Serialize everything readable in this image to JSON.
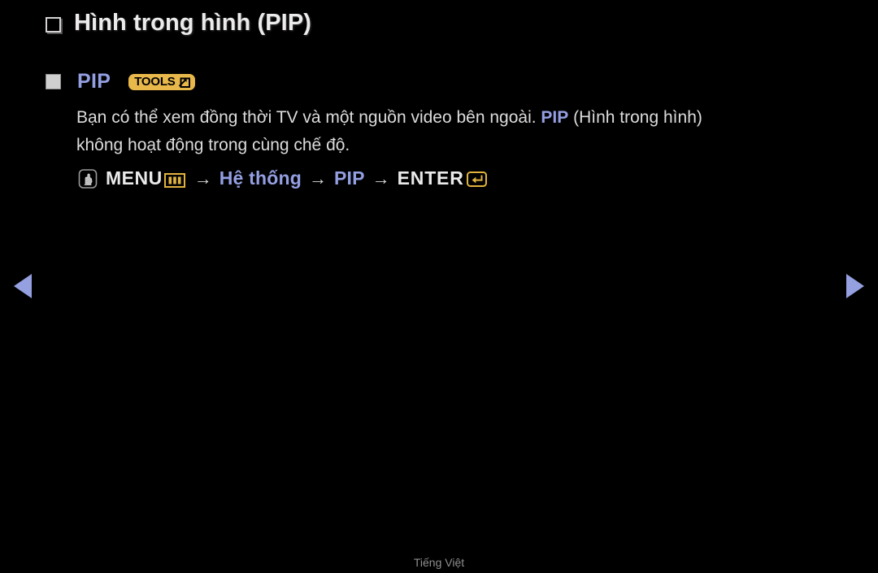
{
  "screen": {
    "background_color": "#000000",
    "accent_blue": "#949fe2",
    "accent_gold": "#e8b84b",
    "text_color": "#dcdcdc"
  },
  "title": {
    "bullet_icon": "hollow-square-bullet-icon",
    "text": "Hình trong hình (PIP)"
  },
  "section": {
    "bullet_icon": "filled-square-bullet-icon",
    "heading": "PIP",
    "tools_badge": {
      "label": "TOOLS",
      "icon": "tools-arrow-icon",
      "background_color": "#e8b84b",
      "text_color": "#000000"
    }
  },
  "body": {
    "line1_part1": "Bạn có thể xem đồng thời TV và một nguồn video bên ngoài. ",
    "line1_highlight": "PIP",
    "line1_part2": " (Hình trong hình)",
    "line2": "không hoạt động trong cùng chế độ."
  },
  "menu_path": {
    "press_icon": "hand-press-button-icon",
    "menu_label": "MENU",
    "menu_icon": "menu-bars-button-icon",
    "separator": "→",
    "step1": "Hệ thống",
    "step2": "PIP",
    "enter_label": "ENTER",
    "enter_icon": "enter-return-button-icon"
  },
  "navigation": {
    "prev_icon": "left-triangle-icon",
    "next_icon": "right-triangle-icon"
  },
  "footer": {
    "language": "Tiếng Việt"
  }
}
